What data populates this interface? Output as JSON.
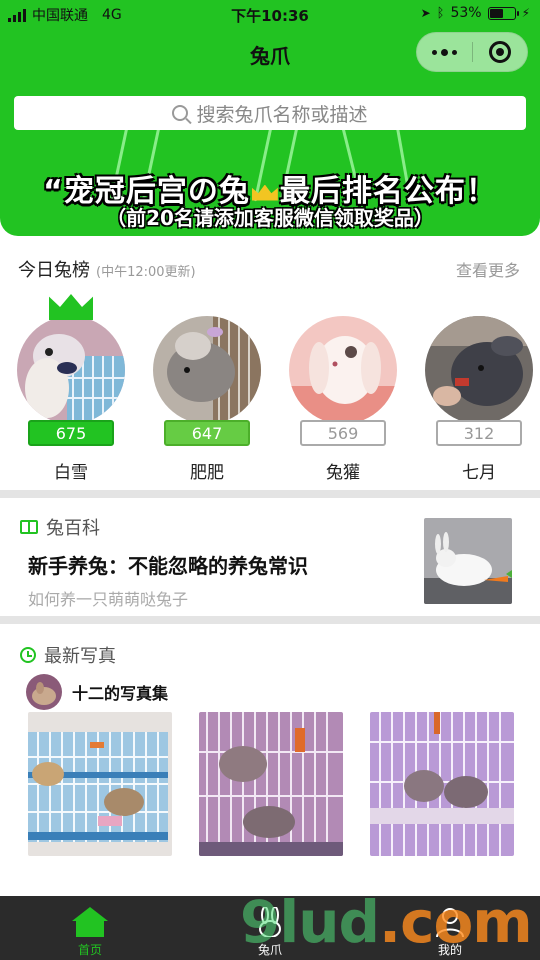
{
  "status_bar": {
    "carrier": "中国联通",
    "network": "4G",
    "time": "下午10:36",
    "battery": "53%",
    "battery_level": 0.53
  },
  "nav": {
    "title": "兔爪"
  },
  "search": {
    "placeholder": "搜索兔爪名称或描述"
  },
  "banner": {
    "line1_a": "“宠冠后宫の兔",
    "line1_b": "最后排名公布！",
    "line2": "（前20名请添加客服微信领取奖品）"
  },
  "ranking": {
    "title": "今日兔榜",
    "note": "(中午12:00更新)",
    "more": "查看更多",
    "items": [
      {
        "name": "白雪",
        "score": "675"
      },
      {
        "name": "肥肥",
        "score": "647"
      },
      {
        "name": "兔獾",
        "score": "569"
      },
      {
        "name": "七月",
        "score": "312"
      }
    ]
  },
  "encyclopedia": {
    "title": "兔百科",
    "headline": "新手养兔：不能忽略的养兔常识",
    "subtitle": "如何养一只萌萌哒兔子"
  },
  "photos": {
    "title": "最新写真",
    "album_name": "十二的写真集"
  },
  "tabbar": {
    "tabs": [
      {
        "label": "首页"
      },
      {
        "label": "兔爪"
      },
      {
        "label": "我的"
      }
    ]
  },
  "watermark": {
    "text_a": "9lud",
    "text_b": ".com"
  },
  "colors": {
    "brand_green": "#22c322",
    "tab_bar": "#2b2b2b",
    "divider": "#e4e4e4"
  }
}
